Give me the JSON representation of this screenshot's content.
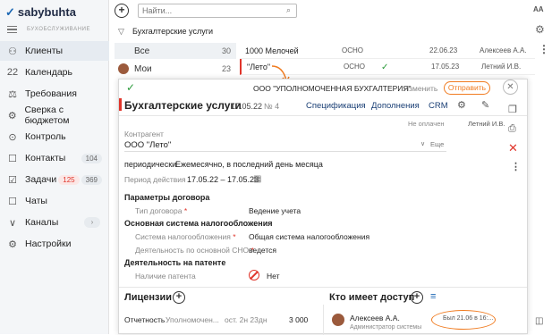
{
  "app": {
    "logo_brand": "sabybuhta",
    "logo_subtitle": "БУХОБСЛУЖИВАНИЕ"
  },
  "sidebar": {
    "items": [
      {
        "icon": "people-icon",
        "label": "Клиенты"
      },
      {
        "icon": "calendar-icon",
        "label": "Календарь",
        "icon_text": "22"
      },
      {
        "icon": "requirements-icon",
        "label": "Требования"
      },
      {
        "icon": "budget-icon",
        "label": "Сверка с бюджетом"
      },
      {
        "icon": "control-icon",
        "label": "Контроль"
      },
      {
        "icon": "contacts-icon",
        "label": "Контакты",
        "badge": "104"
      },
      {
        "icon": "tasks-icon",
        "label": "Задачи",
        "badge_red": "125",
        "badge": "369"
      },
      {
        "icon": "chats-icon",
        "label": "Чаты"
      },
      {
        "icon": "channels-icon",
        "label": "Каналы",
        "chevron": "›"
      },
      {
        "icon": "settings-icon",
        "label": "Настройки"
      }
    ]
  },
  "topbar": {
    "search_placeholder": "Найти...",
    "font_label": "AA"
  },
  "folders": {
    "title": "Бухгалтерские услуги",
    "rows": [
      {
        "label": "Все",
        "count": "30"
      },
      {
        "label": "Мои",
        "count": "23"
      }
    ]
  },
  "list": {
    "rows": [
      {
        "name": "1000 Мелочей",
        "tax": "ОСНО",
        "date": "22.06.23",
        "person": "Алексеев А.А."
      },
      {
        "name": "\"Лето\"",
        "tax": "ОСНО",
        "date": "17.05.23",
        "person": "Летний И.В."
      }
    ]
  },
  "card": {
    "org": "ООО \"УПОЛНОМОЧЕННАЯ БУХГАЛТЕРИЯ\"",
    "change": "Изменить",
    "send": "Отправить",
    "title": "Бухгалтерские услуги",
    "date": "17.05.22",
    "number": "№ 4",
    "tabs": [
      "Спецификация",
      "Дополнения",
      "CRM"
    ],
    "status": "Не оплачен",
    "responsible": "Летний И.В.",
    "counterparty_label": "Контрагент",
    "counterparty": "ООО \"Лето\"",
    "more": "Еще",
    "periodic_label": "периодически",
    "periodic_value": "Ежемесячно, в последний день месяца",
    "period_label": "Период действия",
    "period_value": "17.05.22 – 17.05.23",
    "params_title": "Параметры договора",
    "contract_type_label": "Тип договора",
    "contract_type_value": "Ведение учета",
    "tax_title": "Основная система налогообложения",
    "tax_system_label": "Система налогообложения",
    "tax_system_value": "Общая система налогообложения",
    "activity_label": "Деятельность по основной СНО",
    "activity_value": "ведется",
    "patent_title": "Деятельность на патенте",
    "patent_label": "Наличие патента",
    "patent_value": "Нет",
    "licenses_title": "Лицензии",
    "report_label": "Отчетность",
    "report_value": "Уполномочен...",
    "report_period": "ост. 2н 23дн",
    "report_amount": "3 000",
    "access_title": "Кто имеет доступ",
    "access_person": "Алексеев А.А.",
    "access_role": "Администратор системы",
    "access_status": "Был 21.06 в 16:..."
  }
}
